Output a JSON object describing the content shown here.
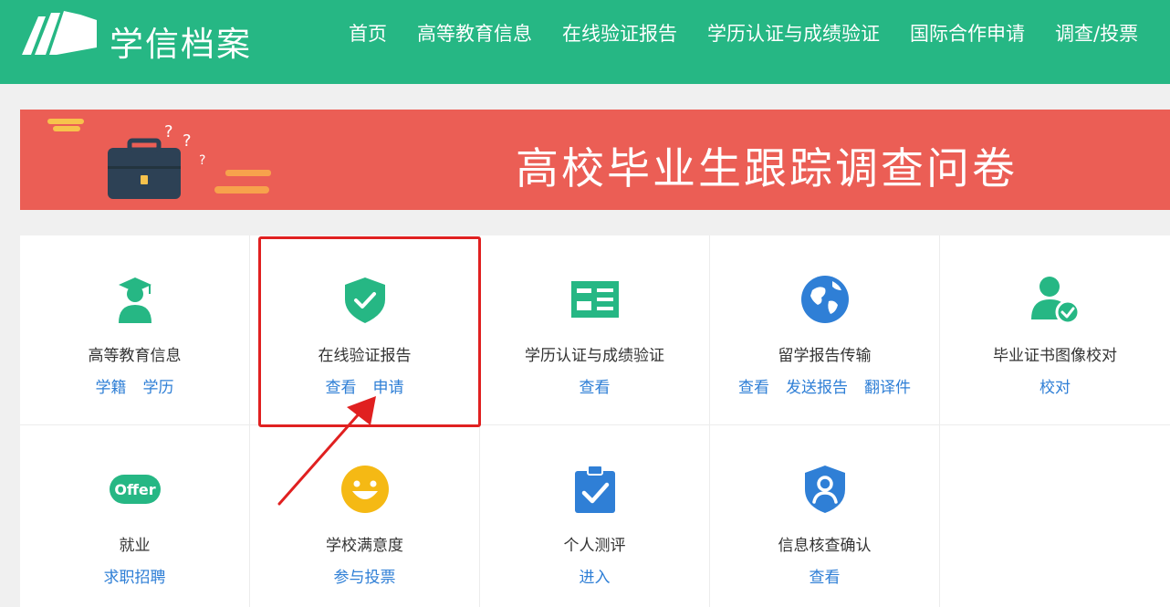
{
  "header": {
    "brand": "学信档案",
    "nav": [
      "首页",
      "高等教育信息",
      "在线验证报告",
      "学历认证与成绩验证",
      "国际合作申请",
      "调查/投票"
    ]
  },
  "banner": {
    "title": "高校毕业生跟踪调查问卷"
  },
  "services": [
    {
      "title": "高等教育信息",
      "links": [
        "学籍",
        "学历"
      ],
      "icon": "graduate-icon"
    },
    {
      "title": "在线验证报告",
      "links": [
        "查看",
        "申请"
      ],
      "icon": "shield-check-icon"
    },
    {
      "title": "学历认证与成绩验证",
      "links": [
        "查看"
      ],
      "icon": "id-card-icon"
    },
    {
      "title": "留学报告传输",
      "links": [
        "查看",
        "发送报告",
        "翻译件"
      ],
      "icon": "globe-icon"
    },
    {
      "title": "毕业证书图像校对",
      "links": [
        "校对"
      ],
      "icon": "user-check-icon"
    },
    {
      "title": "就业",
      "links": [
        "求职招聘"
      ],
      "icon": "offer-icon",
      "icon_text": "Offer"
    },
    {
      "title": "学校满意度",
      "links": [
        "参与投票"
      ],
      "icon": "smile-icon"
    },
    {
      "title": "个人测评",
      "links": [
        "进入"
      ],
      "icon": "clipboard-check-icon"
    },
    {
      "title": "信息核查确认",
      "links": [
        "查看"
      ],
      "icon": "shield-user-icon"
    }
  ],
  "colors": {
    "header": "#26b784",
    "banner": "#eb5e55",
    "link": "#2f7fd6",
    "icon_green": "#26b784",
    "icon_blue": "#2f7fd6",
    "icon_yellow": "#f5b914",
    "highlight": "#e02020"
  }
}
